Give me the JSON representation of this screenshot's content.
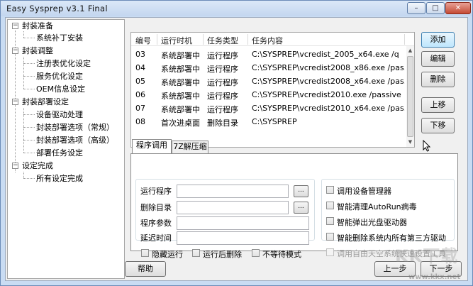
{
  "window": {
    "title": "Easy Sysprep v3.1 Final"
  },
  "caption_buttons": {
    "min": "–",
    "max": "□",
    "close": "✕"
  },
  "tree": [
    {
      "label": "封装准备",
      "expander": "−"
    },
    {
      "label": "系统补丁安装"
    },
    {
      "label": "封装调整",
      "expander": "−"
    },
    {
      "label": "注册表优化设定"
    },
    {
      "label": "服务优化设定"
    },
    {
      "label": "OEM信息设定"
    },
    {
      "label": "封装部署设定",
      "expander": "−"
    },
    {
      "label": "设备驱动处理"
    },
    {
      "label": "封装部署选项（常规）"
    },
    {
      "label": "封装部署选项（高级）"
    },
    {
      "label": "部署任务设定"
    },
    {
      "label": "设定完成",
      "expander": "−"
    },
    {
      "label": "所有设定完成"
    }
  ],
  "task_list": {
    "columns": [
      "编号",
      "运行时机",
      "任务类型",
      "任务内容"
    ],
    "rows": [
      {
        "id": "03",
        "timing": "系统部署中",
        "type": "运行程序",
        "content": "C:\\SYSPREP\\vcredist_2005_x64.exe /q"
      },
      {
        "id": "04",
        "timing": "系统部署中",
        "type": "运行程序",
        "content": "C:\\SYSPREP\\vcredist2008_x86.exe /pas..."
      },
      {
        "id": "05",
        "timing": "系统部署中",
        "type": "运行程序",
        "content": "C:\\SYSPREP\\vcredist2008_x64.exe /pas..."
      },
      {
        "id": "06",
        "timing": "系统部署中",
        "type": "运行程序",
        "content": "C:\\SYSPREP\\vcredist2010.exe /passive"
      },
      {
        "id": "07",
        "timing": "系统部署中",
        "type": "运行程序",
        "content": "C:\\SYSPREP\\vcredist2010_x64.exe /pas..."
      },
      {
        "id": "08",
        "timing": "首次进桌面",
        "type": "删除目录",
        "content": "C:\\SYSPREP"
      }
    ]
  },
  "side_buttons": {
    "add": "添加",
    "edit": "编辑",
    "delete": "删除",
    "up": "上移",
    "down": "下移"
  },
  "tabs": [
    "程序调用",
    "7Z解压缩"
  ],
  "form": {
    "run_program_label": "运行程序",
    "run_program_value": "",
    "delete_dir_label": "删除目录",
    "delete_dir_value": "",
    "params_label": "程序参数",
    "params_value": "",
    "delay_label": "延迟时间",
    "delay_value": "",
    "browse": "...",
    "hidden_run": "隐藏运行",
    "delete_after_run": "运行后删除",
    "no_wait": "不等待模式"
  },
  "options": {
    "device_manager": "调用设备管理器",
    "clean_autorun": "智能清理AutoRun病毒",
    "eject_cd": "智能弹出光盘驱动器",
    "delete_third_party": "智能删除系统内所有第三方驱动",
    "tiankong_tool": "调用自由天空系统快速设置工具"
  },
  "footer": {
    "help": "帮助",
    "prev": "上一步",
    "next": "下一步"
  },
  "watermark": {
    "logo": "KK下载",
    "url": "www.kkx.net"
  }
}
